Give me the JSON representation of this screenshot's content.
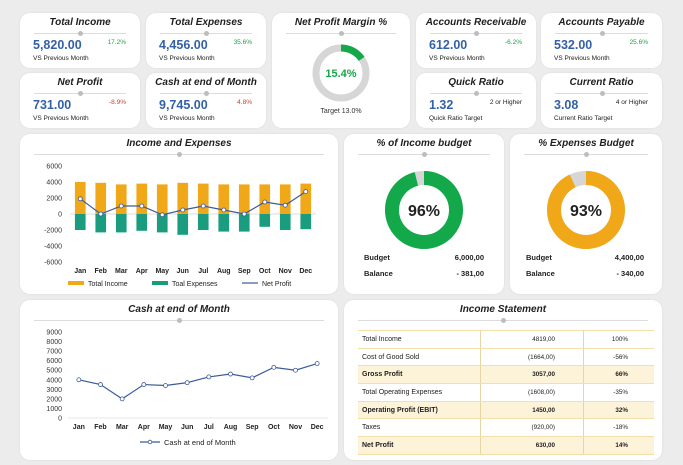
{
  "kpis": {
    "total_income": {
      "title": "Total Income",
      "value": "5,820.00",
      "pct": "17.2%",
      "sub": "VS Previous Month"
    },
    "total_expenses": {
      "title": "Total Expenses",
      "value": "4,456.00",
      "pct": "35.6%",
      "sub": "VS Previous Month"
    },
    "net_profit": {
      "title": "Net Profit",
      "value": "731.00",
      "pct": "-8.9%",
      "sub": "VS Previous Month"
    },
    "cash_end": {
      "title": "Cash at end of Month",
      "value": "9,745.00",
      "pct": "4.8%",
      "sub": "VS Previous Month"
    },
    "accounts_receivable": {
      "title": "Accounts Receivable",
      "value": "612.00",
      "pct": "-6.2%",
      "sub": "VS Previous Month"
    },
    "accounts_payable": {
      "title": "Accounts Payable",
      "value": "532.00",
      "pct": "25.6%",
      "sub": "VS Previous Month"
    },
    "quick_ratio": {
      "title": "Quick Ratio",
      "value": "1.32",
      "note": "2 or Higher",
      "sub": "Quick Ratio Target"
    },
    "current_ratio": {
      "title": "Current Ratio",
      "value": "3.08",
      "note": "4 or Higher",
      "sub": "Current Ratio Target"
    }
  },
  "net_margin": {
    "title": "Net Profit Margin %",
    "value": "15.4%",
    "fraction": 0.154,
    "target": "Target 13.0%"
  },
  "income_budget": {
    "title": "% of Income budget",
    "value": "96%",
    "fraction": 0.96,
    "budget_label": "Budget",
    "budget": "6,000,00",
    "balance_label": "Balance",
    "balance": "- 381,00"
  },
  "expense_budget": {
    "title": "% Expenses Budget",
    "value": "93%",
    "fraction": 0.93,
    "budget_label": "Budget",
    "budget": "4,400,00",
    "balance_label": "Balance",
    "balance": "- 340,00"
  },
  "colors": {
    "gold": "#f0a818",
    "teal": "#1a9c7e",
    "navy": "#3c5a9a",
    "green": "#13a84a",
    "grey": "#d6d6d6",
    "blue": "#3461a6"
  },
  "chart_data": [
    {
      "type": "bar",
      "title": "Income and Expenses",
      "categories": [
        "Jan",
        "Feb",
        "Mar",
        "Apr",
        "May",
        "Jun",
        "Jul",
        "Aug",
        "Sep",
        "Oct",
        "Nov",
        "Dec"
      ],
      "ylim": [
        -6000,
        6000
      ],
      "yticks": [
        6000,
        4000,
        2000,
        0,
        -2000,
        -4000,
        -6000
      ],
      "series": [
        {
          "name": "Total Income",
          "kind": "bar",
          "values": [
            4000,
            3900,
            3700,
            3800,
            3700,
            3900,
            3800,
            3700,
            3700,
            3700,
            3700,
            3800
          ]
        },
        {
          "name": "Toal Expenses",
          "kind": "bar",
          "values": [
            -2000,
            -2300,
            -2300,
            -2100,
            -2300,
            -2600,
            -2000,
            -2200,
            -2200,
            -1600,
            -2000,
            -1900
          ]
        },
        {
          "name": "Net Profit",
          "kind": "line",
          "values": [
            1900,
            0,
            1000,
            1000,
            -100,
            500,
            1000,
            500,
            0,
            1500,
            1100,
            2800
          ]
        }
      ]
    },
    {
      "type": "line",
      "title": "Cash at end of Month",
      "categories": [
        "Jan",
        "Feb",
        "Mar",
        "Apr",
        "May",
        "Jun",
        "Jul",
        "Aug",
        "Sep",
        "Oct",
        "Nov",
        "Dec"
      ],
      "ylim": [
        0,
        9000
      ],
      "yticks": [
        9000,
        8000,
        7000,
        6000,
        5000,
        4000,
        3000,
        2000,
        1000,
        0
      ],
      "series": [
        {
          "name": "Cash at end of Month",
          "values": [
            4000,
            3500,
            2000,
            3500,
            3400,
            3700,
            4300,
            4600,
            4200,
            5300,
            5000,
            5700
          ]
        }
      ]
    }
  ],
  "income_statement": {
    "title": "Income Statement",
    "rows": [
      {
        "label": "Total Income",
        "value": "4819,00",
        "pct": "100%",
        "hl": false
      },
      {
        "label": "Cost of Good Sold",
        "value": "(1664,00)",
        "pct": "-56%",
        "hl": false
      },
      {
        "label": "Gross Profit",
        "value": "3057,00",
        "pct": "66%",
        "hl": true
      },
      {
        "label": "Total Operating Expenses",
        "value": "(1608,00)",
        "pct": "-35%",
        "hl": false
      },
      {
        "label": "Operating Profit (EBIT)",
        "value": "1450,00",
        "pct": "32%",
        "hl": true
      },
      {
        "label": "Taxes",
        "value": "(920,00)",
        "pct": "-18%",
        "hl": false
      },
      {
        "label": "Net Profit",
        "value": "630,00",
        "pct": "14%",
        "hl": true
      }
    ]
  }
}
